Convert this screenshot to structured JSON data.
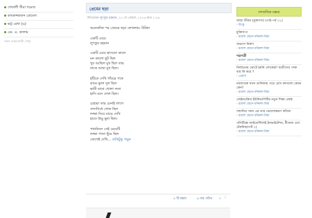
{
  "left_sidebar": {
    "items": [
      {
        "label": "শেফালী সীমা গমেজ"
      },
      {
        "label": "কামরুজ্জামান রোমেল"
      },
      {
        "label": "ভট্ট রেখা (৬)"
      },
      {
        "label": "এম. এ. কালাম"
      }
    ],
    "all_writers": "সকল ব্যবহারকারী দেখুন"
  },
  "post": {
    "title": "প্রেমের ছড়া",
    "meta_prefix": "লিখেছেন ",
    "meta_author": "লুৎফুর রহমান",
    "meta_suffix": ", ২১ শে এপ্রিল, ২০১৬ রাত ১:২৪",
    "lines": [
      "অনেকদিন পর প্রেমের ছড়া লেখলাম। টাটকা",
      "",
      "একটি মেয়ে",
      "লুৎফুর রহমান",
      "",
      "একটি মেয়ে হাসতো কালে",
      "মন কালো ছুট ছিল",
      "খুব আছিল মুখ ছিল তার",
      "নাকে আছা মুখ ছিল।",
      "",
      "হাঁটতে দেখি গাঁয়ের পথে",
      "কানে ঝুলা দুল ছিল",
      "ভাবী মাথে খোলা লতা",
      "হাসি মনে দোল ছিল।",
      "",
      "চেহারা তার চেনাই লাগে",
      "সাদাসিধে গোল ছিল",
      "লজ্জা দিয়ে ঘাড়ে দেখি",
      "হাতে উড়ু ভুল ছিল।",
      "",
      "পথ্যনিলে সেই মেয়েটি",
      "লজ্জা পাতা ছুঁয়ে ছিল",
      "জেগেই দেখি..."
    ],
    "read_more": "বাকিটুকু পড়ুন",
    "footer": {
      "likes": "৪ টি মন্তব্য",
      "views": "৯ বার পঠিত",
      "score": "০"
    }
  },
  "right_panel": {
    "heading": "সাম্প্রতিক মন্তব্য",
    "items": [
      {
        "title": "আহা জীবন (মুক্তগদ্য) (পাঠ-পর্ব ০১)",
        "author": "- রিংকু",
        "bold": false
      },
      {
        "title": "মুক্তিসংগ",
        "author": "- রফেল ছোনে মনিরুল মিয়া",
        "bold": false
      },
      {
        "title": "অভ্যাস নির্মাণ",
        "author": "- রফেল ছোনে মনিরুল মিয়া",
        "bold": false
      },
      {
        "title": "পত্রপত্রী",
        "author": "- রফেল ছোনে মনিরুল মিয়া",
        "bold": true
      },
      {
        "title": "নির্বাচনের ভোটে হয়নি লোকেরা! ছাত্রীসের পদক বার কি করে ?",
        "author": "- প্রেরণা",
        "bold": false
      },
      {
        "title": "নবজাতক যখন তালিকায় পড়ে চোখ কাদালো কেমন কেন?",
        "author": "- রফেল ছোনে মনিরুল মিয়া",
        "bold": false
      },
      {
        "title": "জেষ্ঠ্যভক্তির ইউনিভার্সিটির নতুন শিক্ষা প্রবন্ধ",
        "author": "- রফেল ছোনে মনিরুল মিয়া",
        "bold": false
      },
      {
        "title": "সম্মানিত সময় এর তার ভোরসাক্ষরণ কবিতা",
        "author": "- রফেল ছোনে মনিরুল মিয়া",
        "bold": false
      },
      {
        "title": "পলিটিক্সে আইডেন্টিফাই ইনভাইটেশন, টীনেজ এবং টেকনিক/পার্ট ২)",
        "author": "- রফেল ছোনে মনিরুল মিয়া",
        "bold": false
      }
    ]
  }
}
